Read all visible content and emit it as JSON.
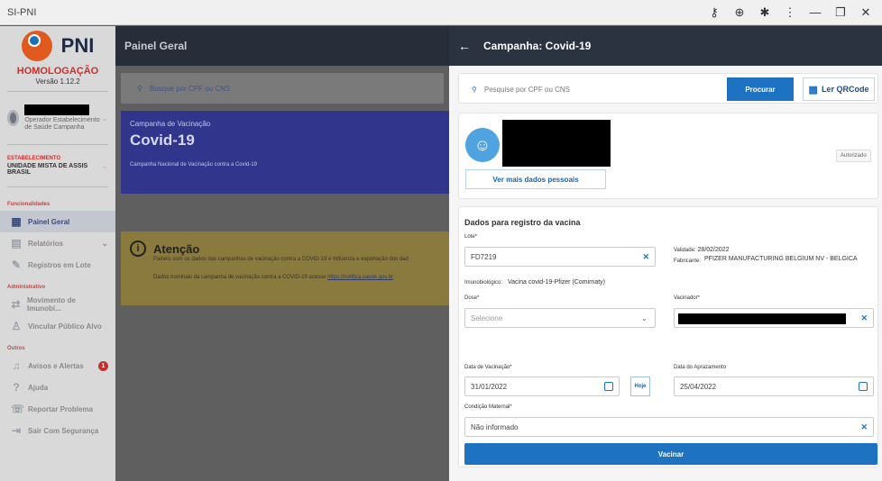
{
  "window": {
    "title": "SI-PNI",
    "controls": [
      "key-icon",
      "zoom-icon",
      "extension-icon",
      "menu-icon",
      "minimize-icon",
      "restore-icon",
      "close-icon"
    ]
  },
  "sidebar": {
    "logo_text": "PNI",
    "env": "HOMOLOGAÇÃO",
    "version": "Versão 1.12.2",
    "user_role": "Operador Estabelecimento de Saúde Campanha",
    "estab_label": "ESTABELECIMENTO",
    "estab_value": "UNIDADE MISTA DE ASSIS BRASIL",
    "sections": {
      "func": "Funcionalidades",
      "admin": "Administrativo",
      "outros": "Outros"
    },
    "items": [
      {
        "label": "Painel Geral",
        "icon": "dashboard-icon"
      },
      {
        "label": "Relatórios",
        "icon": "reports-icon"
      },
      {
        "label": "Registros em Lote",
        "icon": "batch-icon"
      },
      {
        "label": "Movimento de Imunobi...",
        "icon": "movement-icon"
      },
      {
        "label": "Vincular Público Alvo",
        "icon": "users-icon"
      },
      {
        "label": "Avisos e Alertas",
        "icon": "bell-icon",
        "badge": "1"
      },
      {
        "label": "Ajuda",
        "icon": "help-icon"
      },
      {
        "label": "Reportar Problema",
        "icon": "report-icon"
      },
      {
        "label": "Sair Com Segurança",
        "icon": "logout-icon"
      }
    ]
  },
  "main": {
    "header": "Painel Geral",
    "search_placeholder": "Busque por CPF ou CNS",
    "campaign": {
      "small": "Campanha de Vacinação",
      "big": "Covid-19",
      "desc": "Campanha Nacional de Vacinação contra a Covid-19"
    },
    "attention": {
      "title": "Atenção",
      "line1": "Painéis com os dados das campanhas de vacinação contra a COVID-19 e Influenza e exportação dos dad",
      "line2": "Dados nominais da campanha de vacinação contra a COVID-19 acesse",
      "link": "https://notifica.saude.gov.br"
    }
  },
  "panel": {
    "header": "Campanha: Covid-19",
    "search_placeholder": "Pesquise por CPF ou CNS",
    "search_button": "Procurar",
    "qr_button": "Ler QRCode",
    "more_button": "Ver mais dados pessoais",
    "authorized": "Autorizado",
    "form": {
      "title": "Dados para registro da vacina",
      "lote_label": "Lote*",
      "lote_value": "FD7219",
      "validade_label": "Validade:",
      "validade_value": "28/02/2022",
      "fabricante_label": "Fabricante:",
      "fabricante_value": "PFIZER MANUFACTURING BELGIUM NV - BELGICA",
      "imuno_label": "Imunobiológico:",
      "imuno_value": "Vacina covid-19-Pfizer (Comirnaty)",
      "dose_label": "Dose*",
      "dose_placeholder": "Selecione",
      "vacinador_label": "Vacinador*",
      "data_vac_label": "Data de Vacinação*",
      "data_vac_value": "31/01/2022",
      "hoje": "Hoje",
      "data_apraz_label": "Data do Aprazamento",
      "data_apraz_value": "25/04/2022",
      "cond_label": "Condição Maternal*",
      "cond_value": "Não informado",
      "submit": "Vacinar"
    }
  }
}
